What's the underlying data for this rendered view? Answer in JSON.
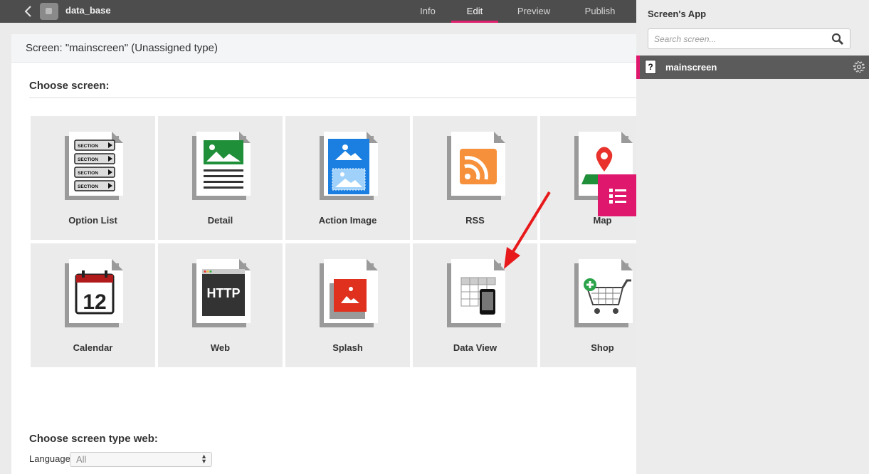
{
  "app": {
    "name": "data_base"
  },
  "tabs": [
    "Info",
    "Edit",
    "Preview",
    "Publish"
  ],
  "active_tab": "Edit",
  "screen_header": "Screen: \"mainscreen\" (Unassigned type)",
  "choose_screen_title": "Choose screen:",
  "tiles": [
    {
      "label": "Option List",
      "icon": "option-list-icon"
    },
    {
      "label": "Detail",
      "icon": "detail-icon"
    },
    {
      "label": "Action Image",
      "icon": "action-image-icon"
    },
    {
      "label": "RSS",
      "icon": "rss-icon"
    },
    {
      "label": "Map",
      "icon": "map-icon"
    },
    {
      "label": "Calendar",
      "icon": "calendar-icon",
      "text": "12"
    },
    {
      "label": "Web",
      "icon": "web-icon",
      "text": "HTTP"
    },
    {
      "label": "Splash",
      "icon": "splash-icon"
    },
    {
      "label": "Data View",
      "icon": "data-view-icon"
    },
    {
      "label": "Shop",
      "icon": "shop-icon"
    }
  ],
  "option_list_section_label": "SECTION",
  "web_type_title": "Choose screen type web:",
  "language": {
    "label": "Language",
    "value": "All"
  },
  "sidebar": {
    "title": "Screen's App",
    "search_placeholder": "Search screen...",
    "screens": [
      {
        "name": "mainscreen",
        "type_icon": "?"
      }
    ]
  },
  "colors": {
    "accent": "#e0186d",
    "topbar": "#4d4d4d",
    "tile_bg": "#ebebeb",
    "annotation_arrow": "#e8191b"
  }
}
